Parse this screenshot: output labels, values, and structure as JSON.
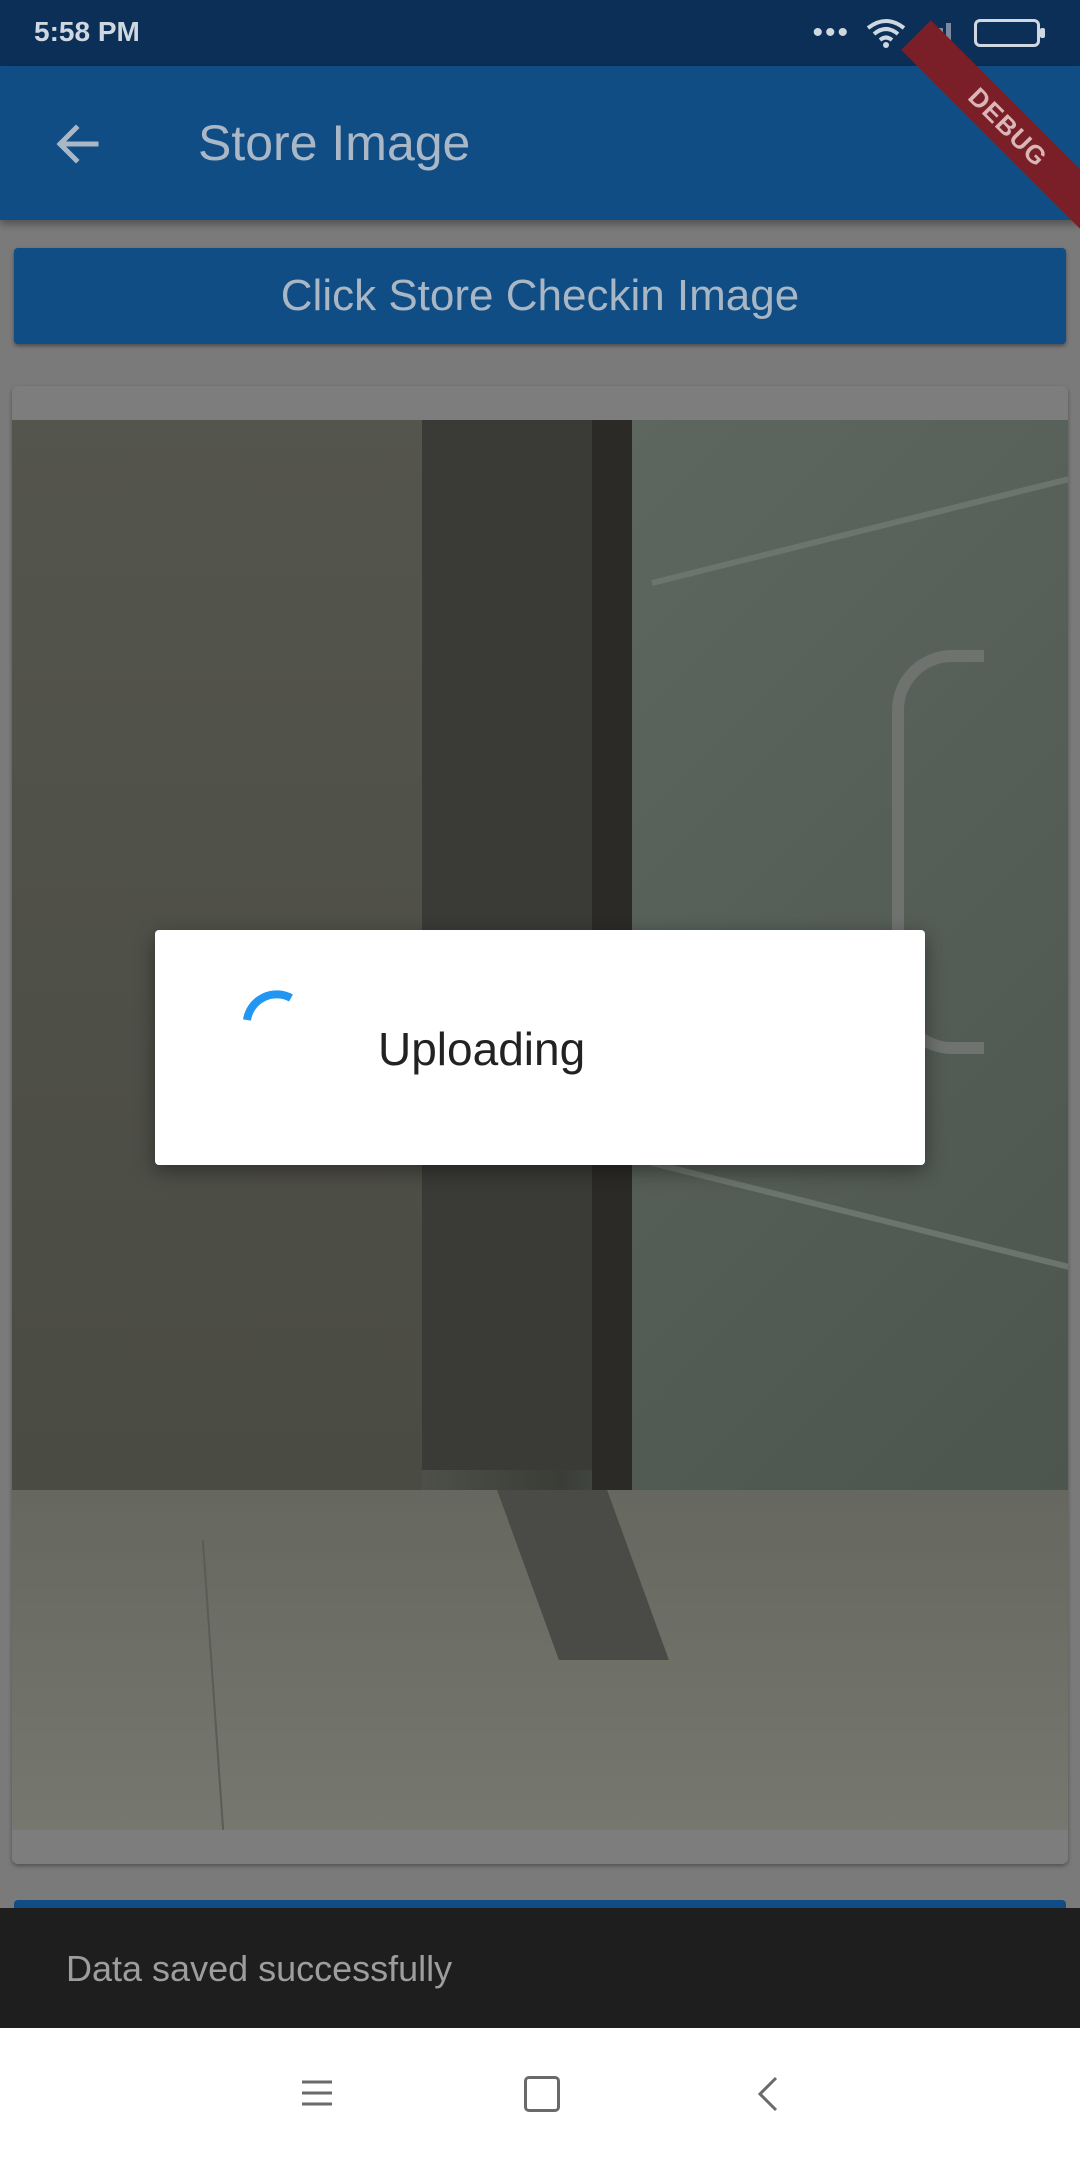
{
  "status_bar": {
    "time": "5:58 PM",
    "more_label": "•••"
  },
  "app_bar": {
    "title": "Store Image",
    "debug_banner": "DEBUG"
  },
  "main": {
    "checkin_button_label": "Click Store Checkin Image"
  },
  "dialog": {
    "text": "Uploading"
  },
  "snackbar": {
    "message": "Data saved successfully"
  },
  "colors": {
    "app_bar": "#1565c0",
    "status_bar": "#0d47a1",
    "spinner": "#2196f3",
    "debug": "#b71c1c"
  },
  "icons": {
    "back": "arrow-back-icon",
    "wifi": "wifi-icon",
    "signal": "signal-icon",
    "battery": "battery-icon",
    "menu": "menu-icon",
    "home": "home-icon",
    "nav_back": "chevron-left-icon"
  }
}
